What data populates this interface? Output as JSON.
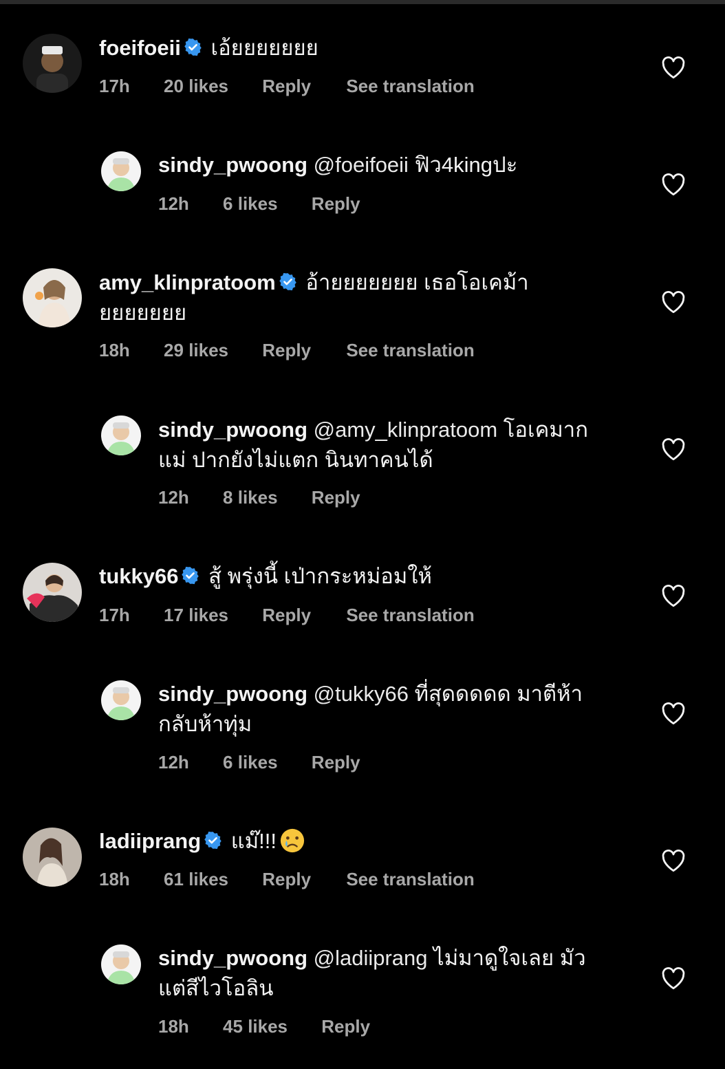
{
  "comments": [
    {
      "username": "foeifoeii",
      "verified": true,
      "text": "เอ้ยยยยยยย",
      "time": "17h",
      "likes": "20 likes",
      "reply": "Reply",
      "translate": "See translation"
    },
    {
      "username": "sindy_pwoong",
      "mention": "@foeifoeii",
      "text": "ฟิว4kingปะ",
      "time": "12h",
      "likes": "6 likes",
      "reply": "Reply"
    },
    {
      "username": "amy_klinpratoom",
      "verified": true,
      "text": "อ้ายยยยยยย เธอโอเคม้า",
      "text2": "ยยยยยยย",
      "time": "18h",
      "likes": "29 likes",
      "reply": "Reply",
      "translate": "See translation"
    },
    {
      "username": "sindy_pwoong",
      "mention": "@amy_klinpratoom",
      "text": "โอเคมาก",
      "text2": "แม่ ปากยังไม่แตก นินทาคนได้",
      "time": "12h",
      "likes": "8 likes",
      "reply": "Reply"
    },
    {
      "username": "tukky66",
      "verified": true,
      "text": "สู้ พรุ่งนี้ เป่ากระหม่อมให้",
      "time": "17h",
      "likes": "17 likes",
      "reply": "Reply",
      "translate": "See translation"
    },
    {
      "username": "sindy_pwoong",
      "mention": "@tukky66",
      "text": "ที่สุดดดดด มาตีห้า",
      "text2": "กลับห้าทุ่ม",
      "time": "12h",
      "likes": "6 likes",
      "reply": "Reply"
    },
    {
      "username": "ladiiprang",
      "verified": true,
      "text": "แม๊!!!",
      "time": "18h",
      "likes": "61 likes",
      "reply": "Reply",
      "translate": "See translation"
    },
    {
      "username": "sindy_pwoong",
      "mention": "@ladiiprang",
      "text": "ไม่มาดูใจเลย มัว",
      "text2": "แต่สีไวโอลิน",
      "time": "18h",
      "likes": "45 likes",
      "reply": "Reply"
    }
  ],
  "colors": {
    "background": "#000000",
    "verified": "#3897f0",
    "meta": "#a8a8a8"
  },
  "icons": {
    "heart": "heart-outline-icon",
    "verified": "verified-badge-icon",
    "emoji": "crying-face-emoji"
  }
}
